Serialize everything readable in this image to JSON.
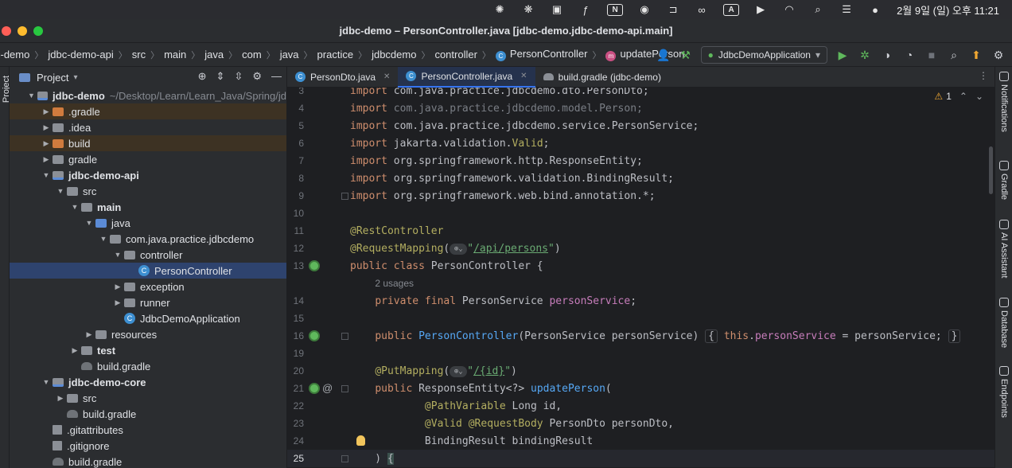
{
  "menubar": {
    "icons": [
      "openai-icon",
      "perplexity-icon",
      "clipboard-icon",
      "figma-icon",
      "notion-icon",
      "shield-icon",
      "bracket-icon",
      "glasses-icon",
      "input-icon",
      "play-icon",
      "wifi-icon",
      "search-icon",
      "control-center-icon",
      "siri-icon"
    ],
    "input_label": "A",
    "notion_label": "N",
    "clock": "2월 9일 (일) 오후 11:21"
  },
  "window": {
    "title": "jdbc-demo – PersonController.java [jdbc-demo.jdbc-demo-api.main]"
  },
  "breadcrumbs": [
    "c-demo",
    "jdbc-demo-api",
    "src",
    "main",
    "java",
    "com",
    "java",
    "practice",
    "jdbcdemo",
    "controller",
    "PersonController",
    "updatePerson"
  ],
  "toolbar": {
    "run_config": "JdbcDemoApplication"
  },
  "left_stripe": {
    "label": "Project"
  },
  "project": {
    "header": "Project",
    "tree": [
      {
        "level": 0,
        "arrow": "down",
        "icon": "module",
        "label": "jdbc-demo",
        "bold": true,
        "extra": "~/Desktop/Learn/Learn_Java/Spring/jd"
      },
      {
        "level": 1,
        "arrow": "right",
        "icon": "orange",
        "label": ".gradle",
        "excluded": true
      },
      {
        "level": 1,
        "arrow": "right",
        "icon": "plain",
        "label": ".idea"
      },
      {
        "level": 1,
        "arrow": "right",
        "icon": "orange",
        "label": "build",
        "excluded": true
      },
      {
        "level": 1,
        "arrow": "right",
        "icon": "plain",
        "label": "gradle"
      },
      {
        "level": 1,
        "arrow": "down",
        "icon": "module",
        "label": "jdbc-demo-api",
        "bold": true
      },
      {
        "level": 2,
        "arrow": "down",
        "icon": "plain",
        "label": "src"
      },
      {
        "level": 3,
        "arrow": "down",
        "icon": "plain",
        "label": "main",
        "bold": true
      },
      {
        "level": 4,
        "arrow": "down",
        "icon": "blue",
        "label": "java"
      },
      {
        "level": 5,
        "arrow": "down",
        "icon": "plain",
        "label": "com.java.practice.jdbcdemo"
      },
      {
        "level": 6,
        "arrow": "down",
        "icon": "plain",
        "label": "controller"
      },
      {
        "level": 7,
        "arrow": "none",
        "icon": "class",
        "label": "PersonController",
        "selected": true
      },
      {
        "level": 6,
        "arrow": "right",
        "icon": "plain",
        "label": "exception"
      },
      {
        "level": 6,
        "arrow": "right",
        "icon": "plain",
        "label": "runner"
      },
      {
        "level": 6,
        "arrow": "none",
        "icon": "class",
        "label": "JdbcDemoApplication"
      },
      {
        "level": 4,
        "arrow": "right",
        "icon": "plain",
        "label": "resources"
      },
      {
        "level": 3,
        "arrow": "right",
        "icon": "plain",
        "label": "test",
        "bold": true
      },
      {
        "level": 3,
        "arrow": "none",
        "icon": "gradle",
        "label": "build.gradle"
      },
      {
        "level": 1,
        "arrow": "down",
        "icon": "module",
        "label": "jdbc-demo-core",
        "bold": true
      },
      {
        "level": 2,
        "arrow": "right",
        "icon": "plain",
        "label": "src"
      },
      {
        "level": 2,
        "arrow": "none",
        "icon": "gradle",
        "label": "build.gradle"
      },
      {
        "level": 1,
        "arrow": "none",
        "icon": "git",
        "label": ".gitattributes"
      },
      {
        "level": 1,
        "arrow": "none",
        "icon": "git",
        "label": ".gitignore"
      },
      {
        "level": 1,
        "arrow": "none",
        "icon": "gradle",
        "label": "build.gradle"
      }
    ]
  },
  "tabs": [
    {
      "label": "PersonDto.java",
      "icon": "class",
      "active": false
    },
    {
      "label": "PersonController.java",
      "icon": "class",
      "active": true
    },
    {
      "label": "build.gradle (jdbc-demo)",
      "icon": "gradle",
      "active": false
    }
  ],
  "editor": {
    "warning_count": "1",
    "current_line": "25",
    "lines": [
      {
        "n": "3",
        "gutter": [],
        "html": "<span class='kw'>import</span> com.java.practice.jdbcdemo.dto.PersonDto;"
      },
      {
        "n": "4",
        "gutter": [],
        "html": "<span class='kw'>import</span> <span class='dim'>com.java.practice.jdbcdemo.model.Person;</span>"
      },
      {
        "n": "5",
        "gutter": [],
        "html": "<span class='kw'>import</span> com.java.practice.jdbcdemo.service.PersonService;"
      },
      {
        "n": "6",
        "gutter": [],
        "html": "<span class='kw'>import</span> jakarta.validation.<span class='ann'>Valid</span>;"
      },
      {
        "n": "7",
        "gutter": [],
        "html": "<span class='kw'>import</span> org.springframework.http.ResponseEntity;"
      },
      {
        "n": "8",
        "gutter": [],
        "html": "<span class='kw'>import</span> org.springframework.validation.BindingResult;"
      },
      {
        "n": "9",
        "gutter": [
          "fold"
        ],
        "html": "<span class='kw'>import</span> org.springframework.web.bind.annotation.*;"
      },
      {
        "n": "10",
        "gutter": [],
        "html": ""
      },
      {
        "n": "11",
        "gutter": [],
        "html": "<span class='ann'>@RestController</span>"
      },
      {
        "n": "12",
        "gutter": [],
        "html": "<span class='ann'>@RequestMapping</span>(<span class='globe'>⊕⌄</span><span class='strp'>\"</span><span class='str'>/api/persons</span><span class='strp'>\"</span>)"
      },
      {
        "n": "13",
        "gutter": [
          "spring"
        ],
        "html": "<span class='kw'>public class</span> PersonController {"
      },
      {
        "n": "",
        "gutter": [],
        "html": "    <span class='hint'>2 usages</span>"
      },
      {
        "n": "14",
        "gutter": [],
        "html": "    <span class='kw'>private final</span> PersonService <span class='fld'>personService</span>;"
      },
      {
        "n": "15",
        "gutter": [],
        "html": ""
      },
      {
        "n": "16",
        "gutter": [
          "spring",
          "fold"
        ],
        "html": "    <span class='kw'>public</span> <span class='mth'>PersonController</span>(PersonService personService) <span class='fold-box'>{</span> <span class='kw'>this</span>.<span class='fld'>personService</span> = personService; <span class='fold-box'>}</span>"
      },
      {
        "n": "19",
        "gutter": [],
        "html": ""
      },
      {
        "n": "20",
        "gutter": [],
        "html": "    <span class='ann'>@PutMapping</span>(<span class='globe'>⊕⌄</span><span class='strp'>\"</span><span class='str'>/{id}</span><span class='strp'>\"</span>)"
      },
      {
        "n": "21",
        "gutter": [
          "spring",
          "at",
          "fold"
        ],
        "html": "    <span class='kw'>public</span> ResponseEntity&lt;?&gt; <span class='mth'>updatePerson</span>("
      },
      {
        "n": "22",
        "gutter": [],
        "html": "            <span class='ann'>@PathVariable</span> Long id,"
      },
      {
        "n": "23",
        "gutter": [],
        "html": "            <span class='ann'>@Valid @RequestBody</span> PersonDto personDto,"
      },
      {
        "n": "24",
        "gutter": [
          "bulb"
        ],
        "html": "            BindingResult bindingResult"
      },
      {
        "n": "25",
        "gutter": [
          "fold"
        ],
        "html": "    ) <span class='cursor-brace'>{</span>",
        "current": true
      }
    ]
  },
  "right_stripe": [
    "Notifications",
    "Gradle",
    "AI Assistant",
    "Database",
    "Endpoints"
  ],
  "colors": {
    "background": "#1e1f22",
    "panel": "#2b2d30",
    "selection": "#2e436e",
    "keyword": "#cf8e6d",
    "annotation": "#b3ae60",
    "string": "#6aab73",
    "field": "#c77dbb",
    "method": "#56a8f5"
  }
}
